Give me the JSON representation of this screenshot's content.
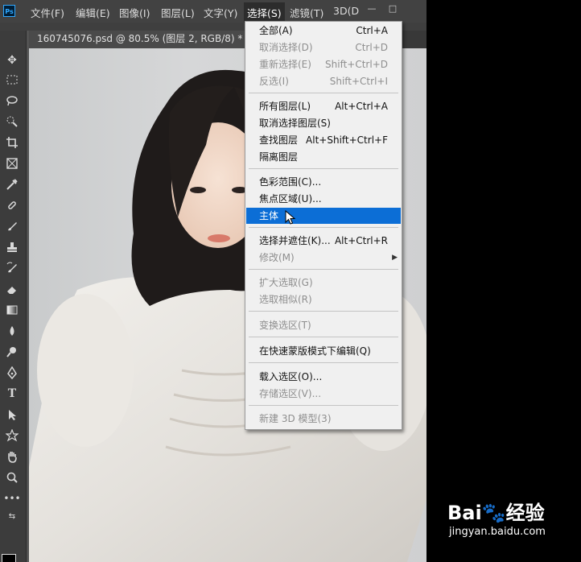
{
  "app": {
    "logo": "Ps",
    "menus": [
      "文件(F)",
      "编辑(E)",
      "图像(I)",
      "图层(L)",
      "文字(Y)",
      "选择(S)",
      "滤镜(T)",
      "3D(D"
    ],
    "window_buttons": [
      "—",
      "□"
    ]
  },
  "document": {
    "tab_title": "160745076.psd @ 80.5% (图层 2, RGB/8) *"
  },
  "tools": [
    "move-tool",
    "marquee-tool",
    "lasso-tool",
    "quick-select-tool",
    "crop-tool",
    "frame-tool",
    "eyedropper-tool",
    "healing-brush-tool",
    "brush-tool",
    "clone-stamp-tool",
    "history-brush-tool",
    "eraser-tool",
    "gradient-tool",
    "blur-tool",
    "dodge-tool",
    "pen-tool",
    "type-tool",
    "path-select-tool",
    "shape-tool",
    "hand-tool",
    "zoom-tool",
    "more-tools"
  ],
  "select_menu": {
    "items": [
      {
        "label": "全部(A)",
        "shortcut": "Ctrl+A",
        "disabled": false
      },
      {
        "label": "取消选择(D)",
        "shortcut": "Ctrl+D",
        "disabled": true
      },
      {
        "label": "重新选择(E)",
        "shortcut": "Shift+Ctrl+D",
        "disabled": true
      },
      {
        "label": "反选(I)",
        "shortcut": "Shift+Ctrl+I",
        "disabled": true
      },
      {
        "label": "所有图层(L)",
        "shortcut": "Alt+Ctrl+A",
        "disabled": false
      },
      {
        "label": "取消选择图层(S)",
        "shortcut": "",
        "disabled": false
      },
      {
        "label": "查找图层",
        "shortcut": "Alt+Shift+Ctrl+F",
        "disabled": false
      },
      {
        "label": "隔离图层",
        "shortcut": "",
        "disabled": false
      },
      {
        "label": "色彩范围(C)...",
        "shortcut": "",
        "disabled": false
      },
      {
        "label": "焦点区域(U)...",
        "shortcut": "",
        "disabled": false
      },
      {
        "label": "主体",
        "shortcut": "",
        "disabled": false,
        "highlighted": true
      },
      {
        "label": "选择并遮住(K)...",
        "shortcut": "Alt+Ctrl+R",
        "disabled": false
      },
      {
        "label": "修改(M)",
        "shortcut": "",
        "disabled": true,
        "submenu": true
      },
      {
        "label": "扩大选取(G)",
        "shortcut": "",
        "disabled": true
      },
      {
        "label": "选取相似(R)",
        "shortcut": "",
        "disabled": true
      },
      {
        "label": "变换选区(T)",
        "shortcut": "",
        "disabled": true
      },
      {
        "label": "在快速蒙版模式下编辑(Q)",
        "shortcut": "",
        "disabled": false
      },
      {
        "label": "载入选区(O)...",
        "shortcut": "",
        "disabled": false
      },
      {
        "label": "存储选区(V)...",
        "shortcut": "",
        "disabled": true
      },
      {
        "label": "新建 3D 模型(3)",
        "shortcut": "",
        "disabled": true
      }
    ]
  },
  "watermark": {
    "logo_text": "Bai🐾经验",
    "url": "jingyan.baidu.com"
  }
}
